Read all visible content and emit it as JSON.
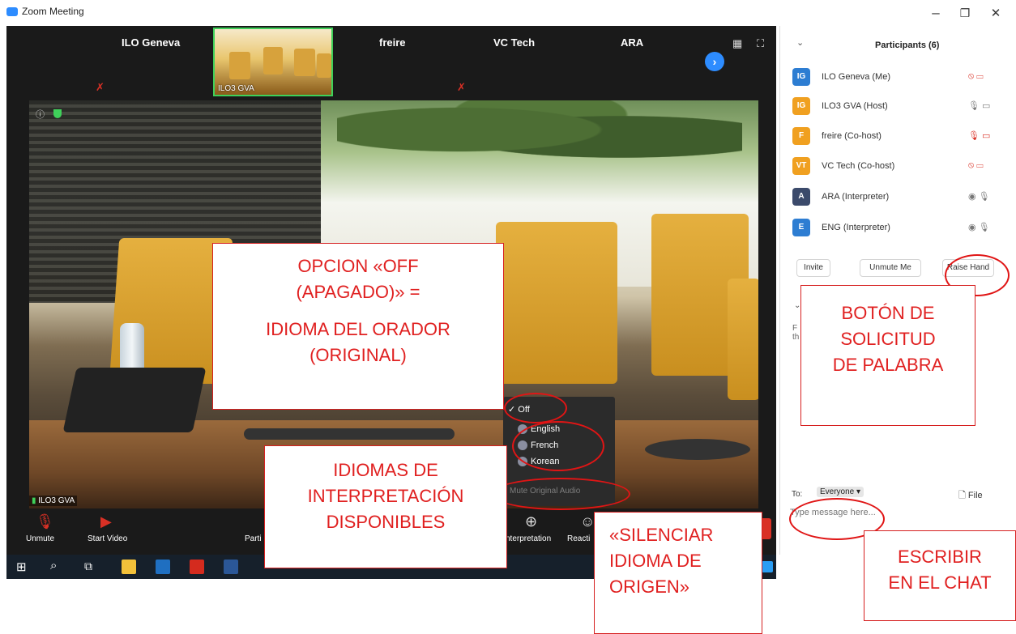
{
  "window": {
    "title": "Zoom Meeting",
    "controls": {
      "minimize": "–",
      "restore": "❐",
      "close": "✕"
    }
  },
  "gallery_strip": {
    "tiles": [
      {
        "name": "ILO Geneva",
        "muted": true
      },
      {
        "name": "ILO3 GVA",
        "active": true
      },
      {
        "name": "freire",
        "muted": true
      },
      {
        "name": "VC Tech",
        "muted": false
      },
      {
        "name": "ARA",
        "muted": false
      }
    ],
    "next_arrow": "›"
  },
  "video": {
    "name_tag": "ILO3 GVA"
  },
  "toolbar": {
    "unmute_label": "Unmute",
    "start_video_label": "Start Video",
    "participants_label_partial": "Parti",
    "interpretation_label_partial": "nterpretation",
    "reactions_label_partial": "Reacti"
  },
  "interpretation_menu": {
    "selected": "Off",
    "items": [
      {
        "label": "Off",
        "checked": true
      },
      {
        "label": "English"
      },
      {
        "label": "French"
      },
      {
        "label": "Korean"
      }
    ],
    "mute_original": "Mute Original Audio"
  },
  "participants_panel": {
    "title": "Participants (6)",
    "participants": [
      {
        "initials": "IG",
        "name": "ILO Geneva (Me)",
        "color": "#2d7dd2"
      },
      {
        "initials": "IG",
        "name": "ILO3 GVA (Host)",
        "color": "#f0a020"
      },
      {
        "initials": "F",
        "name": "freire (Co-host)",
        "color": "#f0a020"
      },
      {
        "initials": "VT",
        "name": "VC Tech (Co-host)",
        "color": "#f0a020"
      },
      {
        "initials": "A",
        "name": "ARA (Interpreter)",
        "color": "#3b4a6b"
      },
      {
        "initials": "E",
        "name": "ENG (Interpreter)",
        "color": "#2d7dd2"
      }
    ],
    "buttons": {
      "invite": "Invite",
      "unmute_me": "Unmute Me",
      "raise_hand": "Raise Hand"
    },
    "chat": {
      "to_label": "To:",
      "recipient": "Everyone",
      "file_label": "File",
      "placeholder": "Type message here...",
      "peek_line1": "F",
      "peek_line2": "th"
    }
  },
  "annotations": {
    "off_option": [
      "OPCION «OFF",
      "(APAGADO)» =",
      "",
      "IDIOMA DEL ORADOR",
      "(ORIGINAL)"
    ],
    "languages": [
      "IDIOMAS DE",
      "INTERPRETACIÓN",
      "DISPONIBLES"
    ],
    "mute_origin": [
      "«SILENCIAR",
      "IDIOMA DE",
      "ORIGEN»"
    ],
    "raise_hand": [
      "BOTÓN DE",
      "SOLICITUD",
      "DE PALABRA"
    ],
    "chat": [
      "ESCRIBIR",
      "EN EL CHAT"
    ]
  },
  "colors": {
    "zoom_blue": "#2d8cff",
    "annotation_red": "#e02020",
    "mute_red": "#d93025",
    "active_green": "#3fd15a"
  }
}
